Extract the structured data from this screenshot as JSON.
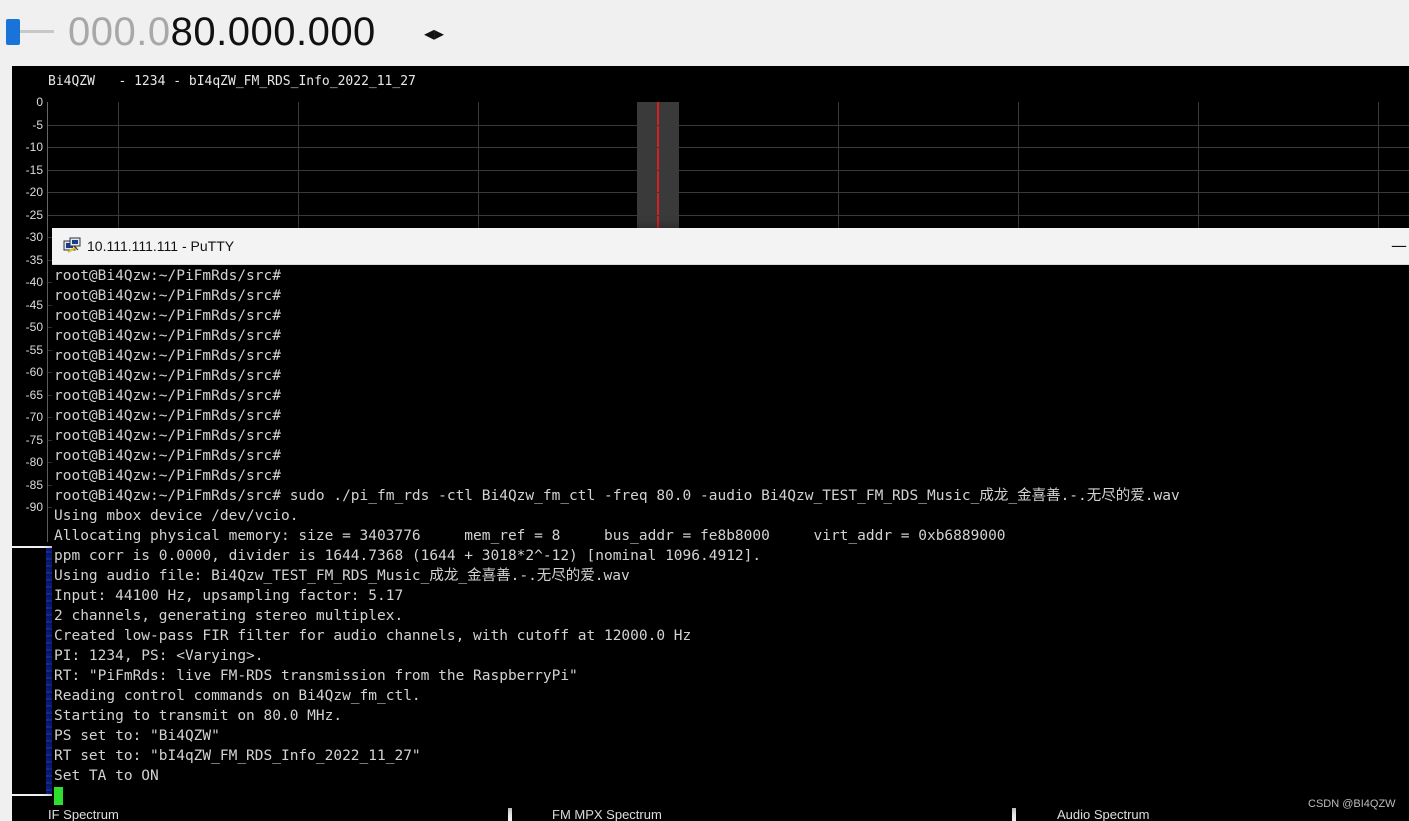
{
  "frequency": {
    "dim_digits": "000.0",
    "main_digits": "80.000.000",
    "arrows_glyph": "◂▸"
  },
  "spectrum": {
    "title": "Bi4QZW   - 1234 - bI4qZW_FM_RDS_Info_2022_11_27",
    "y_ticks": [
      "0",
      "-5",
      "-10",
      "-15",
      "-20",
      "-25",
      "-30",
      "-35",
      "-40",
      "-45",
      "-50",
      "-55",
      "-60",
      "-65",
      "-70",
      "-75",
      "-80",
      "-85",
      "-90"
    ],
    "colors": {
      "carrier": "#d81e1e",
      "grid": "#3a3a3a",
      "background": "#000000"
    }
  },
  "bottom_tabs": [
    "IF Spectrum",
    "FM MPX Spectrum",
    "Audio Spectrum"
  ],
  "putty": {
    "title": "10.111.111.111 - PuTTY",
    "minimize_glyph": "—",
    "icon": "putty-icon",
    "lines": [
      "root@Bi4Qzw:~/PiFmRds/src#",
      "root@Bi4Qzw:~/PiFmRds/src#",
      "root@Bi4Qzw:~/PiFmRds/src#",
      "root@Bi4Qzw:~/PiFmRds/src#",
      "root@Bi4Qzw:~/PiFmRds/src#",
      "root@Bi4Qzw:~/PiFmRds/src#",
      "root@Bi4Qzw:~/PiFmRds/src#",
      "root@Bi4Qzw:~/PiFmRds/src#",
      "root@Bi4Qzw:~/PiFmRds/src#",
      "root@Bi4Qzw:~/PiFmRds/src#",
      "root@Bi4Qzw:~/PiFmRds/src#",
      "root@Bi4Qzw:~/PiFmRds/src# sudo ./pi_fm_rds -ctl Bi4Qzw_fm_ctl -freq 80.0 -audio Bi4Qzw_TEST_FM_RDS_Music_成龙_金喜善.-.无尽的爱.wav",
      "Using mbox device /dev/vcio.",
      "Allocating physical memory: size = 3403776     mem_ref = 8     bus_addr = fe8b8000     virt_addr = 0xb6889000",
      "ppm corr is 0.0000, divider is 1644.7368 (1644 + 3018*2^-12) [nominal 1096.4912].",
      "Using audio file: Bi4Qzw_TEST_FM_RDS_Music_成龙_金喜善.-.无尽的爱.wav",
      "Input: 44100 Hz, upsampling factor: 5.17",
      "2 channels, generating stereo multiplex.",
      "Created low-pass FIR filter for audio channels, with cutoff at 12000.0 Hz",
      "PI: 1234, PS: <Varying>.",
      "RT: \"PiFmRds: live FM-RDS transmission from the RaspberryPi\"",
      "Reading control commands on Bi4Qzw_fm_ctl.",
      "Starting to transmit on 80.0 MHz.",
      "PS set to: \"Bi4QZW\"",
      "RT set to: \"bI4qZW_FM_RDS_Info_2022_11_27\"",
      "Set TA to ON"
    ],
    "colors": {
      "text": "#d2d2d2",
      "cursor": "#2ee02e"
    }
  },
  "watermark": "CSDN @BI4QZW"
}
